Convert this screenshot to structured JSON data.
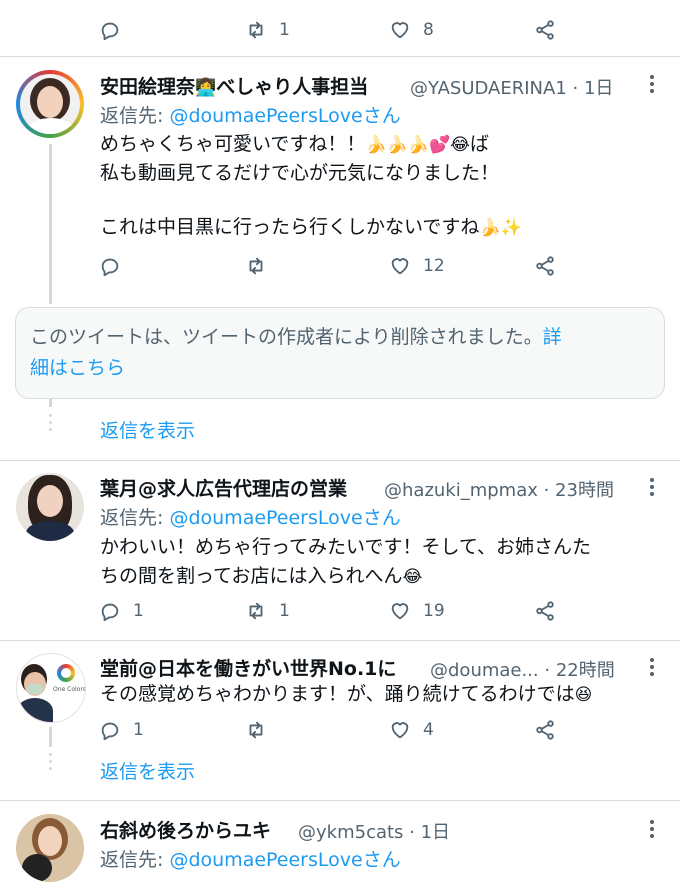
{
  "top_actions": {
    "reply_count": "",
    "retweet_count": "1",
    "like_count": "8"
  },
  "tweets": [
    {
      "name": "安田絵理奈",
      "name_suffix": "べしゃり人事担当",
      "handle_time": "@YASUDAERINA1 · 1日",
      "reply_prefix": "返信先:",
      "reply_to": "@doumaePeersLoveさん",
      "line1": "めちゃくちゃ可愛いですね！！",
      "line1_end": "ば",
      "line2": "私も動画見てるだけで心が元気になりました！",
      "line3": "これは中目黒に行ったら行くしかないですね",
      "reply_count": "",
      "retweet_count": "",
      "like_count": "12"
    },
    {
      "name": "葉月@求人広告代理店の営業",
      "handle_time": "@hazuki_mpmax · 23時間",
      "reply_prefix": "返信先:",
      "reply_to": "@doumaePeersLoveさん",
      "line1": "かわいい！めちゃ行ってみたいです！そして、お姉さんた",
      "line2": "ちの間を割ってお店には入られへん",
      "reply_count": "1",
      "retweet_count": "1",
      "like_count": "19"
    },
    {
      "name": "堂前@日本を働きがい世界No.1に",
      "handle_time": "@doumae... · 22時間",
      "line1": "その感覚めちゃわかります！が、踊り続けてるわけでは",
      "reply_count": "1",
      "retweet_count": "",
      "like_count": "4",
      "avatar_logo_text": "One Colors"
    },
    {
      "name": "右斜め後ろからユキ",
      "handle_time": "@ykm5cats · 1日",
      "reply_prefix": "返信先:",
      "reply_to": "@doumaePeersLoveさん"
    }
  ],
  "deleted_notice": {
    "text": "このツイートは、ツイートの作成者により削除されました。",
    "link1": "詳",
    "link2": "細はこちら"
  },
  "show_replies_1": "返信を表示",
  "show_replies_2": "返信を表示",
  "colors": {
    "link": "#1d9bf0",
    "secondary": "#536471",
    "thread": "#cfd9de",
    "notice_bg": "#f7f9f9"
  }
}
